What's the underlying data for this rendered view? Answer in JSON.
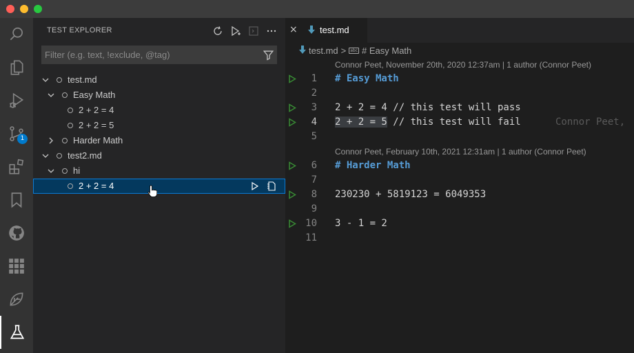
{
  "window": {
    "traffic_lights": [
      "close",
      "minimize",
      "maximize"
    ]
  },
  "activity_bar": {
    "items": [
      {
        "name": "explorer",
        "icon": "files-icon"
      },
      {
        "name": "search",
        "icon": "search-icon"
      },
      {
        "name": "run-and-debug",
        "icon": "debug-icon"
      },
      {
        "name": "source-control",
        "icon": "source-control-icon",
        "badge": "1"
      },
      {
        "name": "extensions",
        "icon": "extensions-icon"
      },
      {
        "name": "bookmarks",
        "icon": "bookmark-icon"
      },
      {
        "name": "github",
        "icon": "github-icon"
      },
      {
        "name": "apps",
        "icon": "grid-icon"
      },
      {
        "name": "remote",
        "icon": "leaf-icon"
      },
      {
        "name": "testing",
        "icon": "flask-icon",
        "active": true
      }
    ],
    "source_control_badge": "1"
  },
  "sidebar": {
    "title": "TEST EXPLORER",
    "actions": [
      "refresh-icon",
      "run-all-icon",
      "show-output-icon",
      "more-icon"
    ],
    "filter_placeholder": "Filter (e.g. text, !exclude, @tag)",
    "tree": [
      {
        "label": "test.md",
        "expanded": true
      },
      {
        "label": "Easy Math",
        "expanded": true
      },
      {
        "label": "2 + 2 = 4"
      },
      {
        "label": "2 + 2 = 5"
      },
      {
        "label": "Harder Math",
        "expanded": false
      },
      {
        "label": "test2.md",
        "expanded": true
      },
      {
        "label": "hi",
        "expanded": true
      },
      {
        "label": "2 + 2 = 4",
        "selected": true
      }
    ]
  },
  "editor": {
    "tab": {
      "label": "test.md",
      "close_icon": "×"
    },
    "breadcrumb": {
      "file": "test.md",
      "separator": ">",
      "symbol": "# Easy Math",
      "symbol_icon": "abc"
    },
    "codelens": [
      "Connor Peet, November 20th, 2020 12:37am | 1 author (Connor Peet)",
      "Connor Peet, February 10th, 2021 12:31am | 1 author (Connor Peet)"
    ],
    "lines": [
      {
        "n": "1",
        "text": "# Easy Math",
        "heading": true,
        "run": true
      },
      {
        "n": "2",
        "text": ""
      },
      {
        "n": "3",
        "text": "2 + 2 = 4 // this test will pass",
        "run": true
      },
      {
        "n": "4",
        "pre": "2 + 2 = 5",
        "text": " // this test will fail",
        "run": true,
        "blame": "Connor Peet,"
      },
      {
        "n": "5",
        "text": ""
      },
      {
        "n": "6",
        "text": "# Harder Math",
        "heading": true,
        "run": true
      },
      {
        "n": "7",
        "text": ""
      },
      {
        "n": "8",
        "text": "230230 + 5819123 = 6049353",
        "run": true
      },
      {
        "n": "9",
        "text": ""
      },
      {
        "n": "10",
        "text": "3 - 1 = 2",
        "run": true
      },
      {
        "n": "11",
        "text": ""
      }
    ]
  },
  "colors": {
    "accent": "#007acc",
    "run_icon": "#388a34",
    "heading": "#569cd6",
    "selection": "#04395e"
  }
}
